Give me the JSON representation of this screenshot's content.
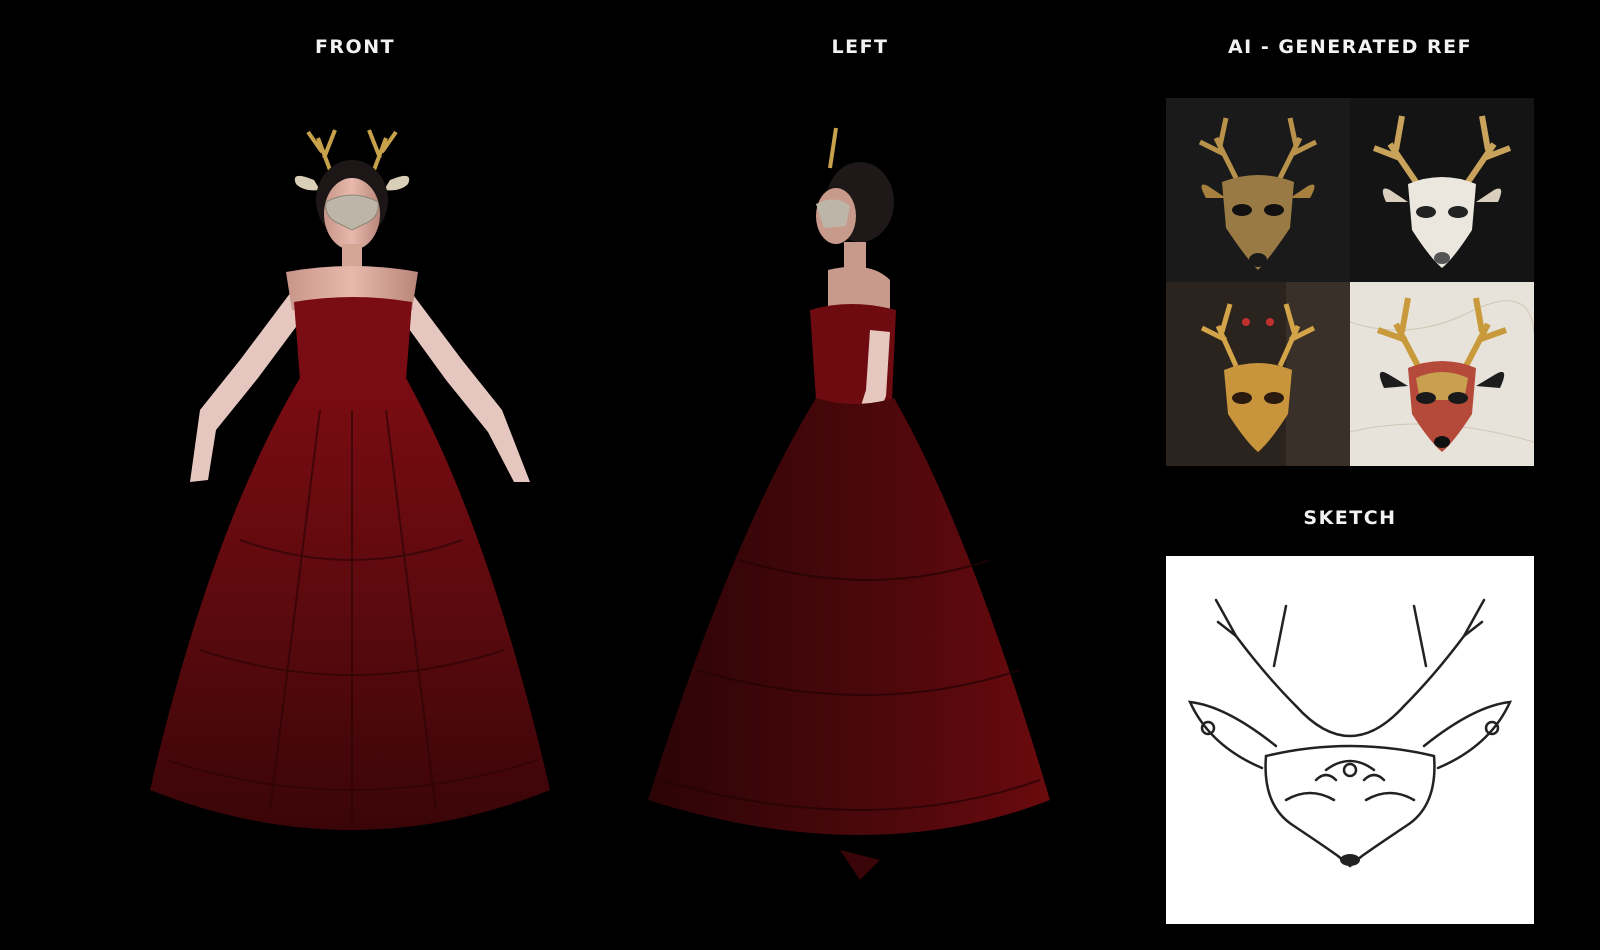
{
  "labels": {
    "front": "FRONT",
    "left": "LEFT",
    "ai_ref": "AI - GENERATED REF",
    "sketch": "SKETCH"
  },
  "colors": {
    "background": "#000000",
    "dress": "#6a0a0e",
    "gold": "#c8a24a",
    "label": "#f2f2f2"
  },
  "figures": [
    {
      "view": "front",
      "subject": "woman in red ball gown with deer mask"
    },
    {
      "view": "left",
      "subject": "woman in red ball gown with deer mask"
    }
  ],
  "reference_tiles": [
    {
      "mask": "gold deer mask",
      "background": "dark"
    },
    {
      "mask": "white and gold deer mask",
      "background": "dark"
    },
    {
      "mask": "gold deer mask with red accents",
      "background": "textured dark"
    },
    {
      "mask": "gold and red deer mask",
      "background": "marble"
    }
  ]
}
